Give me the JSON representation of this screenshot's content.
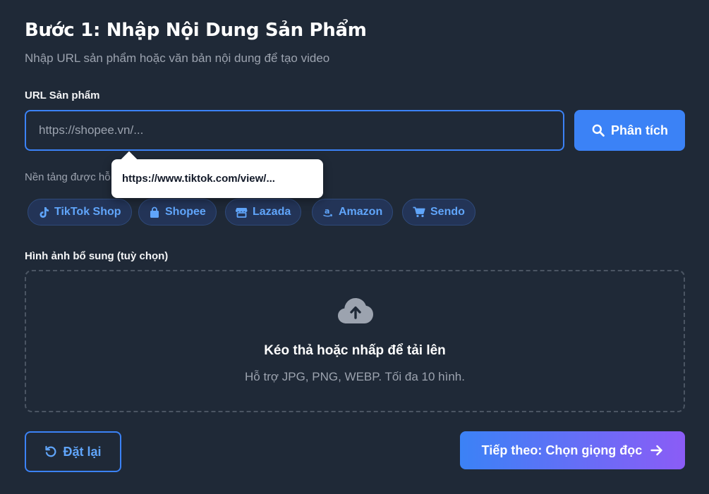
{
  "header": {
    "title": "Bước 1: Nhập Nội Dung Sản Phẩm",
    "subtitle": "Nhập URL sản phẩm hoặc văn bản nội dung để tạo video"
  },
  "url_section": {
    "label": "URL Sản phẩm",
    "input_value": "",
    "placeholder": "https://shopee.vn/...",
    "analyze_button": "Phân tích",
    "tooltip": "https://www.tiktok.com/view/..."
  },
  "platforms": {
    "label": "Nền tảng được hỗ",
    "items": [
      {
        "label": "TikTok Shop",
        "icon": "tiktok-icon"
      },
      {
        "label": "Shopee",
        "icon": "shopping-bag-icon"
      },
      {
        "label": "Lazada",
        "icon": "store-icon"
      },
      {
        "label": "Amazon",
        "icon": "amazon-icon"
      },
      {
        "label": "Sendo",
        "icon": "cart-icon"
      }
    ]
  },
  "images_section": {
    "label": "Hình ảnh bổ sung (tuỳ chọn)",
    "dropzone_title": "Kéo thả hoặc nhấp để tải lên",
    "dropzone_subtitle": "Hỗ trợ JPG, PNG, WEBP. Tối đa 10 hình.",
    "icon": "cloud-upload-icon"
  },
  "footer": {
    "reset_button": "Đặt lại",
    "next_button": "Tiếp theo: Chọn giọng đọc"
  },
  "colors": {
    "background": "#1f2937",
    "accent": "#3b82f6",
    "gradient_end": "#8b5cf6"
  }
}
